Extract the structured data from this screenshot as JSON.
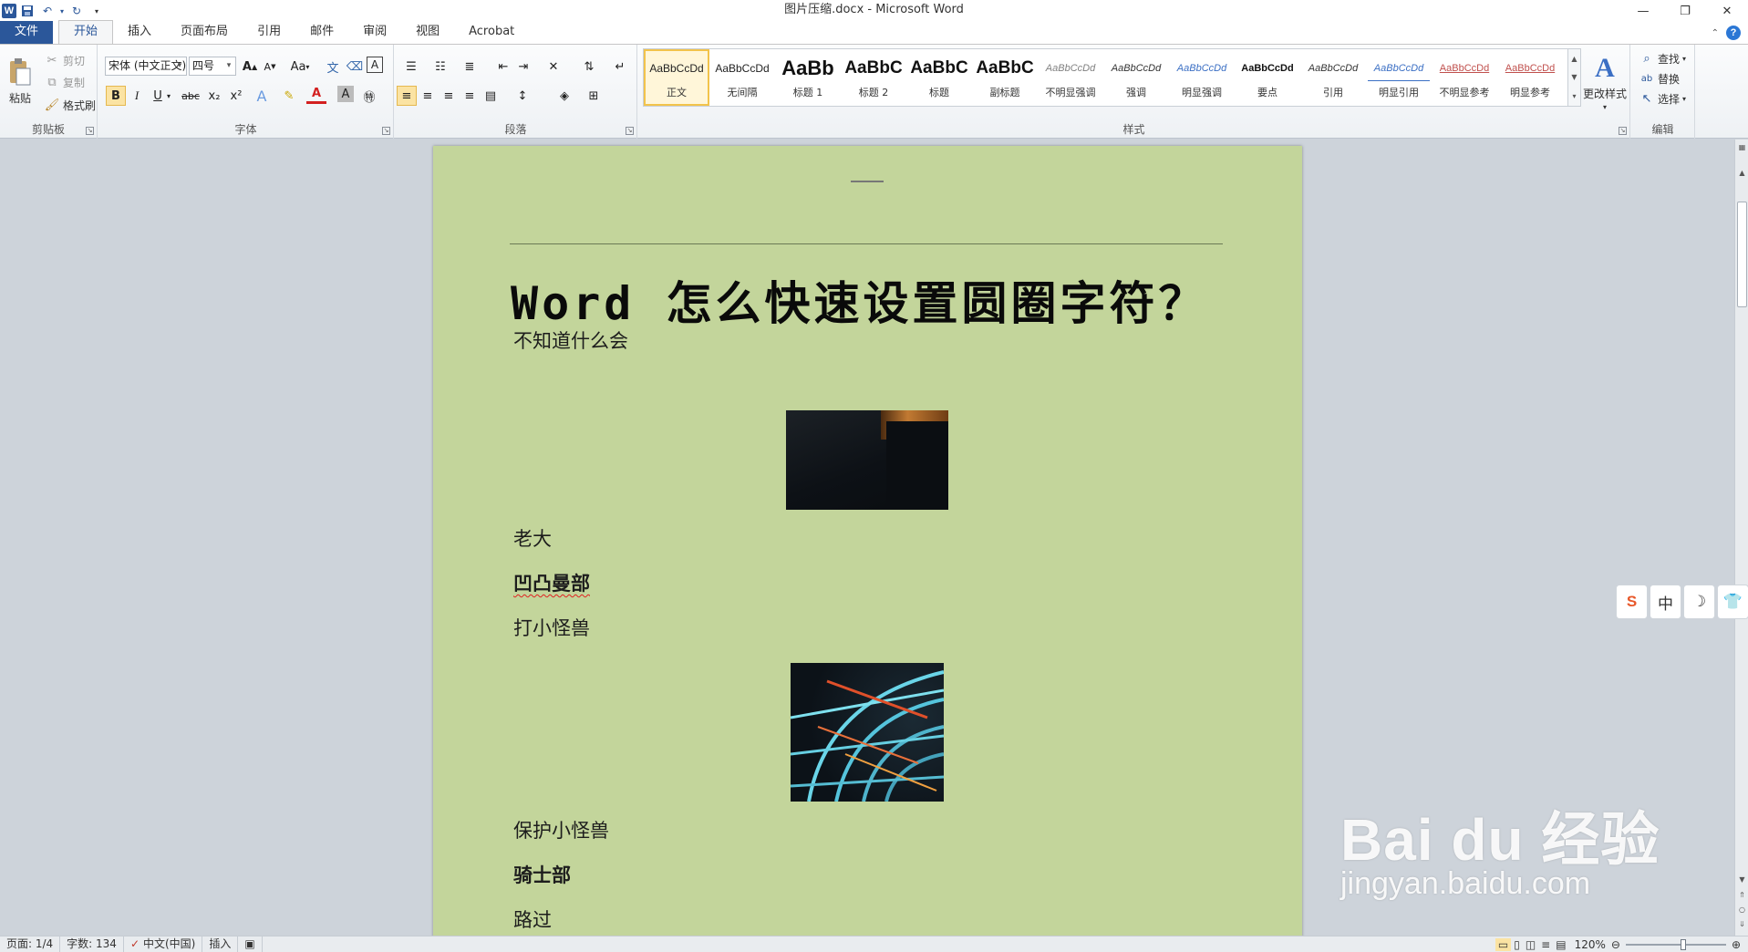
{
  "window": {
    "title": "图片压缩.docx - Microsoft Word",
    "qat_logo": "W"
  },
  "tabs": {
    "file": "文件",
    "items": [
      "开始",
      "插入",
      "页面布局",
      "引用",
      "邮件",
      "审阅",
      "视图",
      "Acrobat"
    ]
  },
  "ribbon": {
    "clipboard": {
      "label": "剪贴板",
      "paste": "粘贴",
      "cut": "剪切",
      "copy": "复制",
      "format_painter": "格式刷"
    },
    "font": {
      "label": "字体",
      "font_name": "宋体 (中文正文)",
      "font_size": "四号",
      "bold": "B",
      "italic": "I",
      "underline": "U",
      "strike": "abc",
      "subscript": "x₂",
      "superscript": "x²",
      "grow": "A",
      "shrink": "A",
      "change_case": "Aa"
    },
    "paragraph": {
      "label": "段落"
    },
    "styles": {
      "label": "样式",
      "items": [
        {
          "sample": "AaBbCcDd",
          "name": "正文",
          "color": "#222222"
        },
        {
          "sample": "AaBbCcDd",
          "name": "无间隔",
          "color": "#222222"
        },
        {
          "sample": "AaBb",
          "name": "标题 1",
          "color": "#111111"
        },
        {
          "sample": "AaBbC",
          "name": "标题 2",
          "color": "#111111"
        },
        {
          "sample": "AaBbC",
          "name": "标题",
          "color": "#111111"
        },
        {
          "sample": "AaBbC",
          "name": "副标题",
          "color": "#111111"
        },
        {
          "sample": "AaBbCcDd",
          "name": "不明显强调",
          "color": "#808080"
        },
        {
          "sample": "AaBbCcDd",
          "name": "强调",
          "color": "#333333"
        },
        {
          "sample": "AaBbCcDd",
          "name": "明显强调",
          "color": "#3b6fc4"
        },
        {
          "sample": "AaBbCcDd",
          "name": "要点",
          "color": "#111111"
        },
        {
          "sample": "AaBbCcDd",
          "name": "引用",
          "color": "#333333"
        },
        {
          "sample": "AaBbCcDd",
          "name": "明显引用",
          "color": "#3b6fc4"
        },
        {
          "sample": "AaBbCcDd",
          "name": "不明显参考",
          "color": "#c0504d"
        },
        {
          "sample": "AaBbCcDd",
          "name": "明显参考",
          "color": "#c0504d"
        }
      ],
      "change_styles": "更改样式"
    },
    "editing": {
      "label": "编辑",
      "find": "查找",
      "replace": "替换",
      "select": "选择"
    }
  },
  "document": {
    "title": "Word 怎么快速设置圆圈字符？",
    "p1": "不知道什么会",
    "p2": "老大",
    "p3": "凹凸曼部",
    "p4": "打小怪兽",
    "p5": "保护小怪兽",
    "p6": "骑士部",
    "p7": "路过"
  },
  "ime": {
    "logo": "S",
    "lang": "中",
    "moon": "☽",
    "skin": "👕"
  },
  "watermark": {
    "brand": "Bai du 经验",
    "url": "jingyan.baidu.com"
  },
  "statusbar": {
    "page": "页面: 1/4",
    "words": "字数: 134",
    "language": "中文(中国)",
    "mode": "插入",
    "zoom": "120%"
  }
}
